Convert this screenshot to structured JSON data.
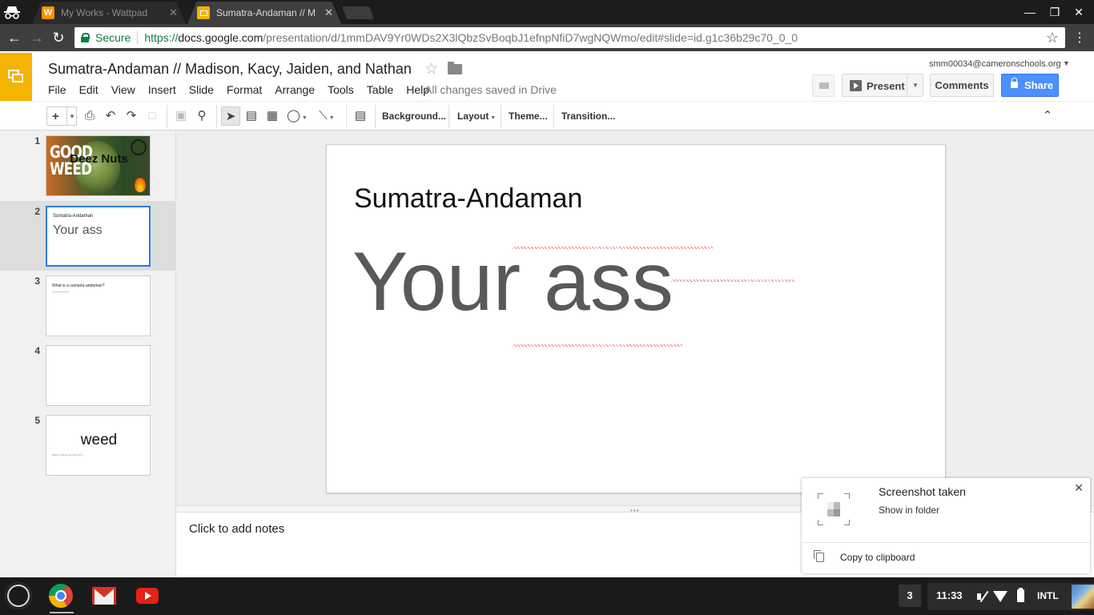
{
  "browser": {
    "tabs": [
      {
        "title": "My Works - Wattpad",
        "favicon": "wattpad-icon",
        "favicon_letter": "W",
        "favicon_color": "#ff8f00"
      },
      {
        "title": "Sumatra-Andaman // M",
        "favicon": "slides-icon",
        "favicon_letter": "",
        "favicon_color": "#f4b400"
      }
    ],
    "tab_close": "✕",
    "window_controls": {
      "minimize": "—",
      "restore": "❐",
      "close": "✕"
    },
    "secure_label": "Secure",
    "url": {
      "scheme": "https://",
      "domain": "docs.google.com",
      "path": "/presentation/d/1mmDAV9Yr0WDs2X3lQbzSvBoqbJ1efnpNfiD7wgNQWmo/edit#slide=id.g1c36b29c70_0_0"
    }
  },
  "app": {
    "doc_title": "Sumatra-Andaman // Madison, Kacy, Jaiden, and Nathan",
    "menu": [
      "File",
      "Edit",
      "View",
      "Insert",
      "Slide",
      "Format",
      "Arrange",
      "Tools",
      "Table",
      "Help"
    ],
    "save_status": "All changes saved in Drive",
    "account": "smm00034@cameronschools.org",
    "present_label": "Present",
    "comments_label": "Comments",
    "share_label": "Share",
    "accent_color": "#4d90fe",
    "brand_color": "#f4b400"
  },
  "toolbar": {
    "new_label": "+",
    "background_label": "Background...",
    "layout_label": "Layout",
    "theme_label": "Theme...",
    "transition_label": "Transition..."
  },
  "filmstrip": {
    "slides": [
      {
        "number": "1",
        "title": "Deez Nuts",
        "image_text": "GOOD WEED"
      },
      {
        "number": "2",
        "small": "Sumatra-Andaman",
        "big": "Your ass"
      },
      {
        "number": "3",
        "small": "What is a sumatra-andaman?"
      },
      {
        "number": "4"
      },
      {
        "number": "5",
        "big": "weed",
        "small": "Bailey, Cutting you can find it"
      }
    ],
    "selected": 2
  },
  "slide": {
    "title": "Sumatra-Andaman",
    "body": "Your ass"
  },
  "notes": {
    "placeholder": "Click to add notes"
  },
  "notification": {
    "title": "Screenshot taken",
    "action": "Show in folder",
    "copy": "Copy to clipboard"
  },
  "shelf": {
    "window_count": "3",
    "time": "11:33",
    "ime": "INTL"
  }
}
